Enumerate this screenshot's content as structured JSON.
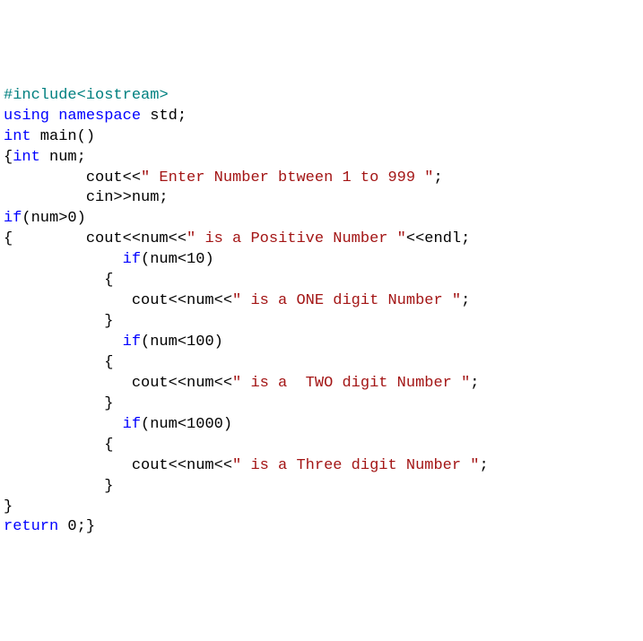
{
  "code": {
    "l1_pp": "#include",
    "l1_hdr": "<iostream>",
    "l2_kw1": "using",
    "l2_kw2": "namespace",
    "l2_rest": " std;",
    "l3_kw": "int",
    "l3_rest": " main()",
    "l4a": "{",
    "l4_kw": "int",
    "l4b": " num;",
    "l5a": "         cout<<",
    "l5s": "\" Enter Number btween 1 to 999 \"",
    "l5b": ";",
    "l6": "         cin>>num;",
    "l7_kw": "if",
    "l7_rest": "(num>0)",
    "l8a": "{        cout<<num<<",
    "l8s": "\" is a Positive Number \"",
    "l8b": "<<endl;",
    "l9": "",
    "l10a": "             ",
    "l10_kw": "if",
    "l10b": "(num<10)",
    "l11": "           {",
    "l12a": "              cout<<num<<",
    "l12s": "\" is a ONE digit Number \"",
    "l12b": ";",
    "l13": "           }",
    "l14": "",
    "l15a": "             ",
    "l15_kw": "if",
    "l15b": "(num<100)",
    "l16": "           {",
    "l17a": "              cout<<num<<",
    "l17s": "\" is a  TWO digit Number \"",
    "l17b": ";",
    "l18": "           }",
    "l19": "",
    "l20a": "             ",
    "l20_kw": "if",
    "l20b": "(num<1000)",
    "l21": "           {",
    "l22a": "              cout<<num<<",
    "l22s": "\" is a Three digit Number \"",
    "l22b": ";",
    "l23": "           }",
    "l24": "}",
    "l25_kw": "return",
    "l25_rest": " 0;}"
  }
}
